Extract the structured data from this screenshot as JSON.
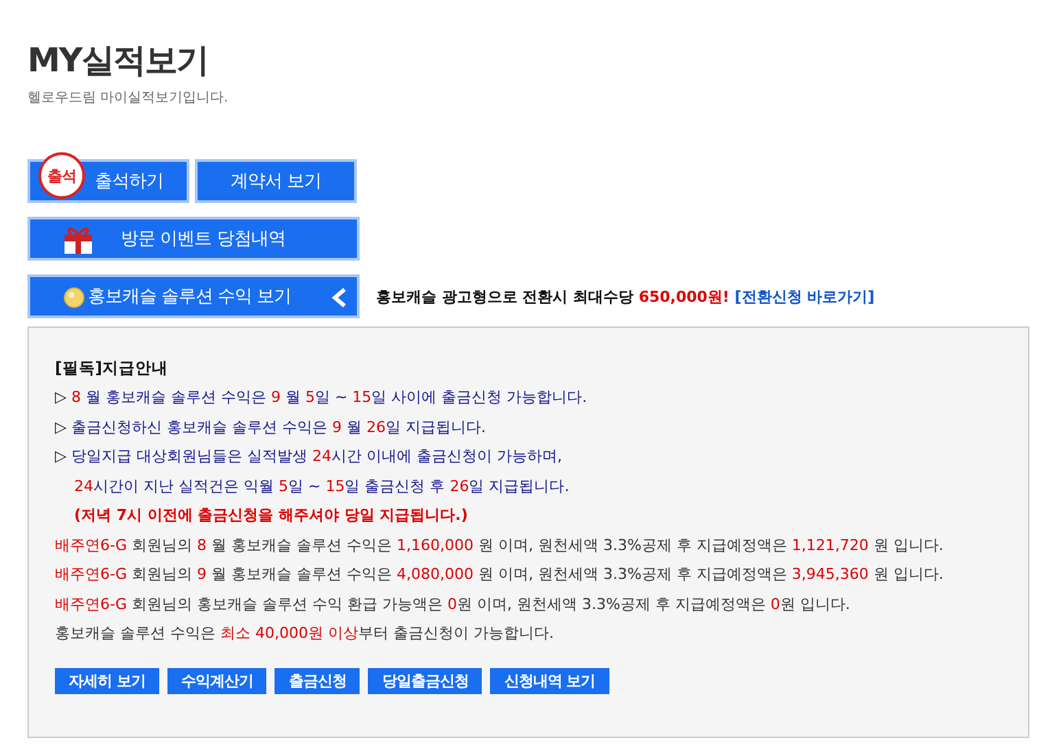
{
  "header": {
    "title": "MY실적보기",
    "subtitle": "헬로우드림 마이실적보기입니다."
  },
  "button_rows": [
    [
      {
        "label": "출석하기",
        "kind": "stamp",
        "stamp_text": "출석"
      },
      {
        "label": "계약서 보기",
        "kind": "plain"
      }
    ],
    [
      {
        "label": "방문 이벤트 당첨내역",
        "kind": "gift"
      }
    ],
    [
      {
        "label": "홍보캐슬 솔루션 수익 보기",
        "kind": "coin"
      }
    ]
  ],
  "promo": {
    "segments": [
      {
        "text": "홍보캐슬 광고형으로 전환시 최대수당 ",
        "kind": "text"
      },
      {
        "text": "650,000원!",
        "kind": "accent"
      }
    ],
    "link": "[전환신청 바로가기]"
  },
  "notice": {
    "title": "[필독]지급안내",
    "lines": [
      {
        "kind": "bullet",
        "segments": [
          {
            "text": "▷ ",
            "kind": "mark"
          },
          {
            "text": "8",
            "kind": "accent"
          },
          {
            "text": " 월 홍보캐슬 솔루션 수익은 ",
            "kind": "text"
          },
          {
            "text": "9",
            "kind": "accent"
          },
          {
            "text": " 월 ",
            "kind": "text"
          },
          {
            "text": "5",
            "kind": "accent"
          },
          {
            "text": "일 ~ ",
            "kind": "text"
          },
          {
            "text": "15",
            "kind": "accent"
          },
          {
            "text": "일 사이에 출금신청 가능합니다.",
            "kind": "text"
          }
        ]
      },
      {
        "kind": "bullet",
        "segments": [
          {
            "text": "▷ ",
            "kind": "mark"
          },
          {
            "text": "출금신청하신 홍보캐슬 솔루션 수익은 ",
            "kind": "text"
          },
          {
            "text": "9",
            "kind": "accent"
          },
          {
            "text": " 월 ",
            "kind": "text"
          },
          {
            "text": "26",
            "kind": "accent"
          },
          {
            "text": "일 지급됩니다.",
            "kind": "text"
          }
        ]
      },
      {
        "kind": "bullet",
        "segments": [
          {
            "text": "▷ ",
            "kind": "mark"
          },
          {
            "text": "당일지급 대상회원님들은 실적발생 ",
            "kind": "text"
          },
          {
            "text": "24",
            "kind": "accent"
          },
          {
            "text": "시간 이내에 출금신청이 가능하며,",
            "kind": "text"
          }
        ]
      },
      {
        "kind": "continuation",
        "segments": [
          {
            "text": "24",
            "kind": "accent"
          },
          {
            "text": "시간이 지난 실적건은 익월 ",
            "kind": "text"
          },
          {
            "text": "5",
            "kind": "accent"
          },
          {
            "text": "일 ~ ",
            "kind": "text"
          },
          {
            "text": "15",
            "kind": "accent"
          },
          {
            "text": "일 출금신청 후 ",
            "kind": "text"
          },
          {
            "text": "26",
            "kind": "accent"
          },
          {
            "text": "일 지급됩니다.",
            "kind": "text"
          }
        ]
      },
      {
        "kind": "warning",
        "segments": [
          {
            "text": "(저녁 7시 이전에 출금신청을 해주셔야 당일 지급됩니다.)",
            "kind": "text"
          }
        ]
      },
      {
        "kind": "dark",
        "segments": [
          {
            "text": "배주연6-G",
            "kind": "accent"
          },
          {
            "text": " 회원님의 ",
            "kind": "text"
          },
          {
            "text": "8",
            "kind": "accent"
          },
          {
            "text": " 월 홍보캐슬 솔루션 수익은 ",
            "kind": "text"
          },
          {
            "text": "1,160,000",
            "kind": "accent"
          },
          {
            "text": " 원 이며, 원천세액 3.3%공제 후 지급예정액은 ",
            "kind": "text"
          },
          {
            "text": "1,121,720",
            "kind": "accent"
          },
          {
            "text": " 원 입니다.",
            "kind": "text"
          }
        ]
      },
      {
        "kind": "dark",
        "segments": [
          {
            "text": "배주연6-G",
            "kind": "accent"
          },
          {
            "text": " 회원님의 ",
            "kind": "text"
          },
          {
            "text": "9",
            "kind": "accent"
          },
          {
            "text": " 월 홍보캐슬 솔루션 수익은 ",
            "kind": "text"
          },
          {
            "text": "4,080,000",
            "kind": "accent"
          },
          {
            "text": " 원 이며, 원천세액 3.3%공제 후 지급예정액은 ",
            "kind": "text"
          },
          {
            "text": "3,945,360",
            "kind": "accent"
          },
          {
            "text": " 원 입니다.",
            "kind": "text"
          }
        ]
      },
      {
        "kind": "dark",
        "segments": [
          {
            "text": "배주연6-G",
            "kind": "accent"
          },
          {
            "text": " 회원님의 홍보캐슬 솔루션 수익 환급 가능액은 ",
            "kind": "text"
          },
          {
            "text": "0",
            "kind": "accent"
          },
          {
            "text": "원 이며, 원천세액 3.3%공제 후 지급예정액은 ",
            "kind": "text"
          },
          {
            "text": "0",
            "kind": "accent"
          },
          {
            "text": "원 입니다.",
            "kind": "text"
          }
        ]
      },
      {
        "kind": "dark",
        "segments": [
          {
            "text": "홍보캐슬 솔루션 수익은 ",
            "kind": "text"
          },
          {
            "text": "최소 40,000원 이상",
            "kind": "accent"
          },
          {
            "text": "부터 출금신청이 가능합니다.",
            "kind": "text"
          }
        ]
      }
    ],
    "actions": [
      "자세히 보기",
      "수익계산기",
      "출금신청",
      "당일출금신청",
      "신청내역 보기"
    ]
  }
}
